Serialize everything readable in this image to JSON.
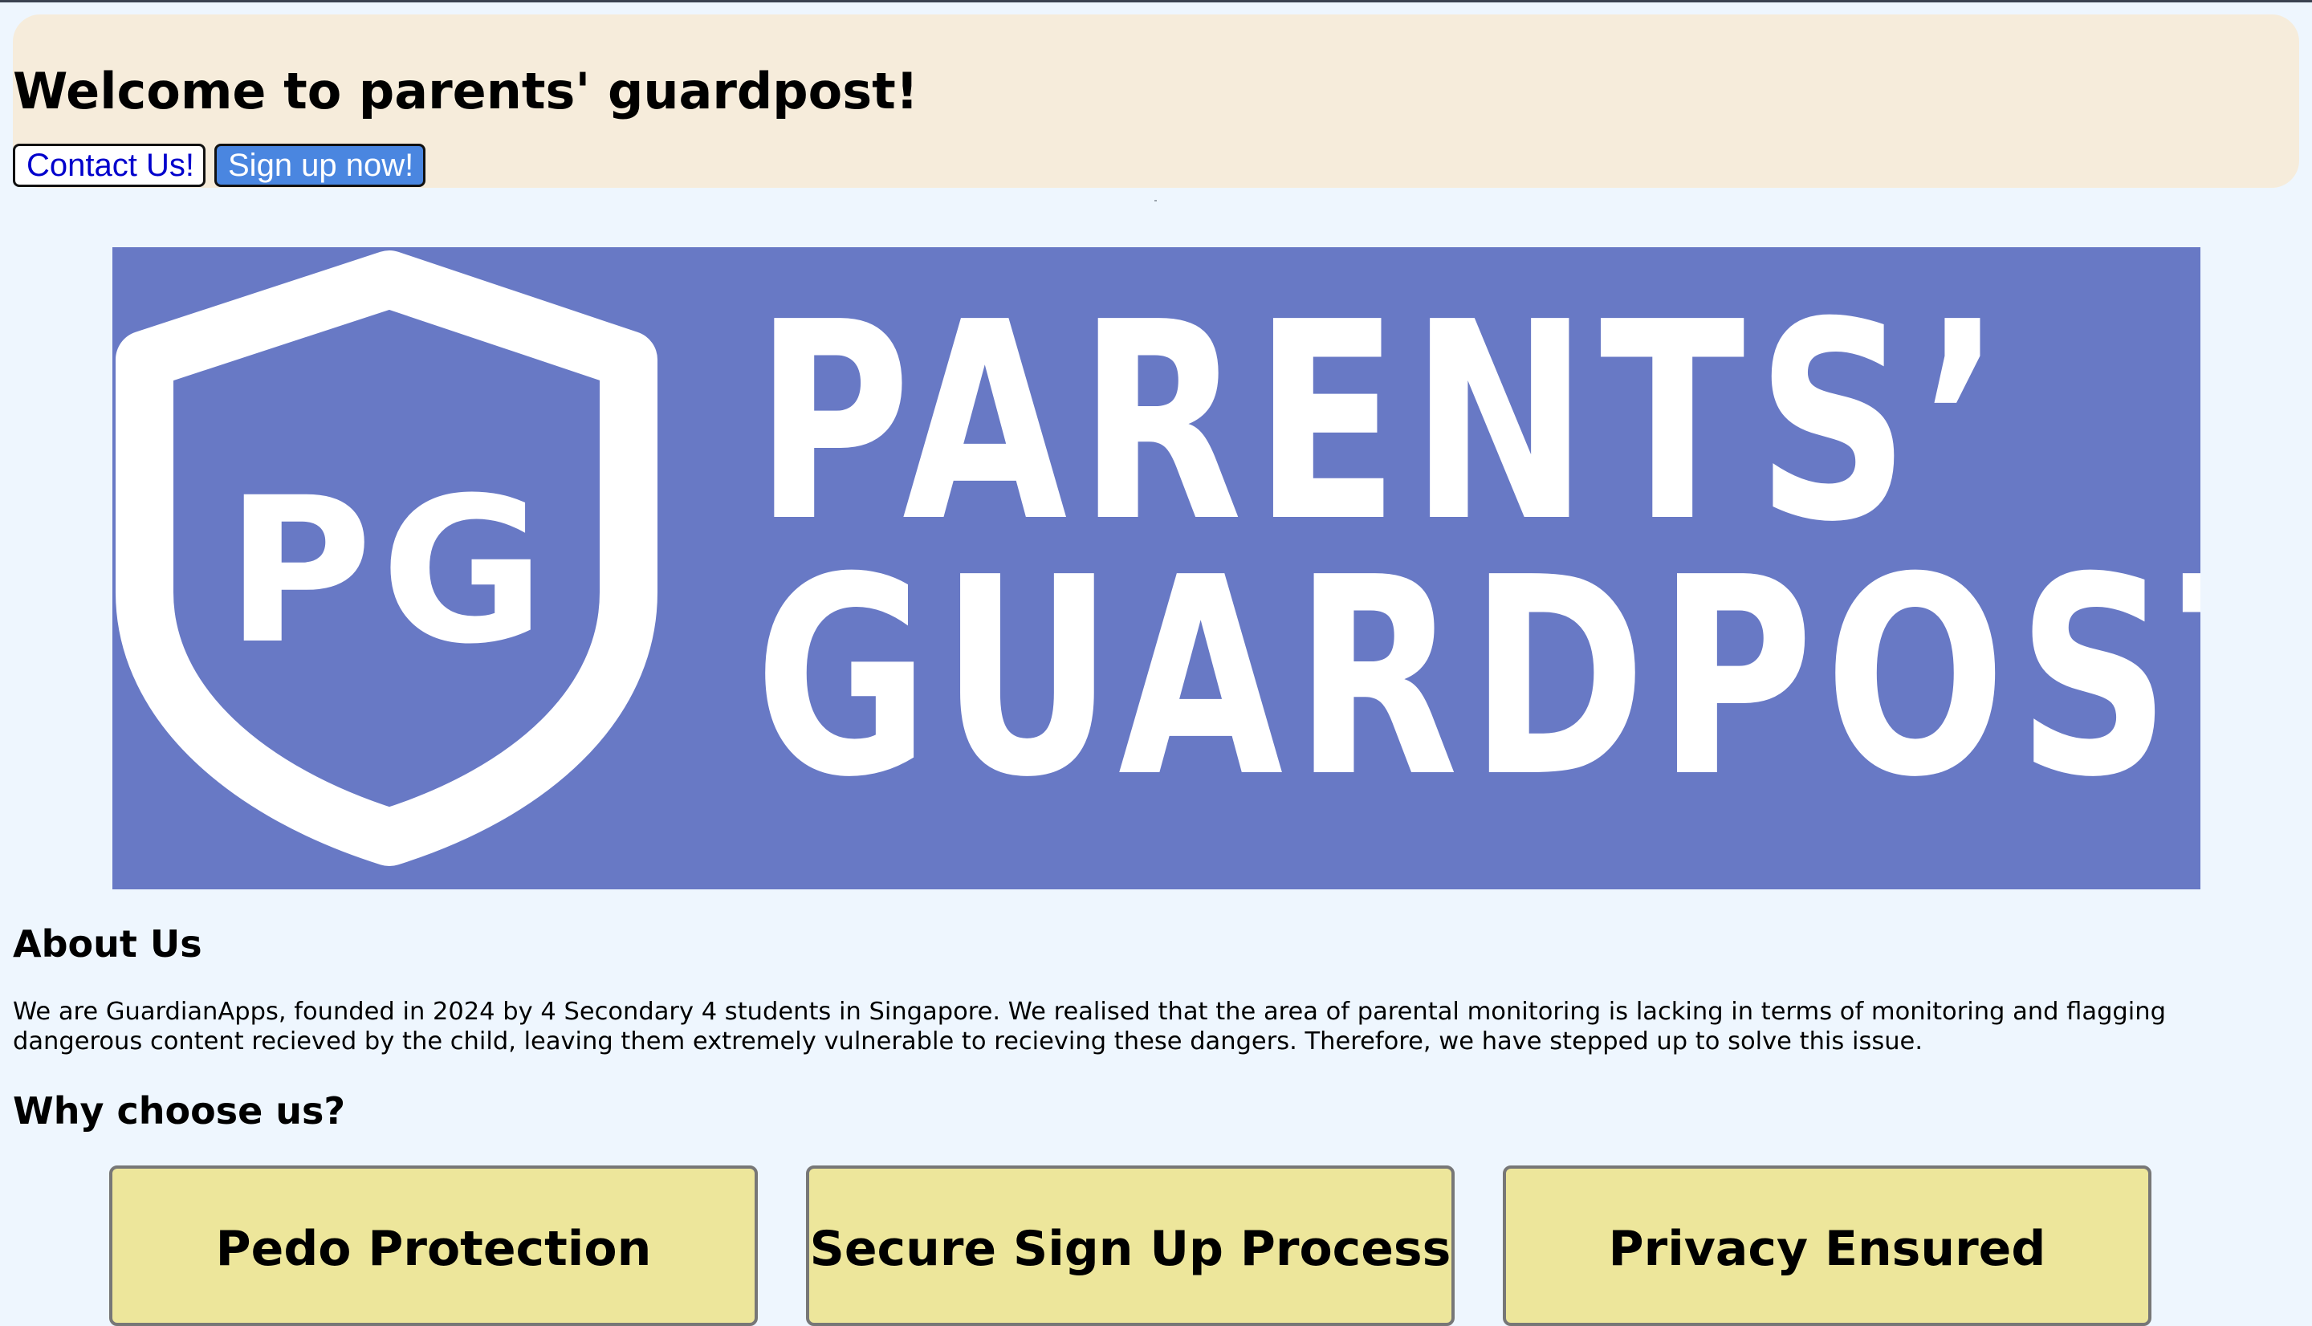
{
  "header": {
    "title": "Welcome to parents' guardpost!",
    "contact_button": "Contact Us!",
    "signup_button": "Sign up now!"
  },
  "banner": {
    "shield_initials": "PG",
    "line1": "PARENTS’",
    "line2": "GUARDPOST",
    "background_color": "#6879c5"
  },
  "about": {
    "heading": "About Us",
    "text": "We are GuardianApps, founded in 2024 by 4 Secondary 4 students in Singapore. We realised that the area of parental monitoring is lacking in terms of monitoring and flagging dangerous content recieved by the child, leaving them extremely vulnerable to recieving these dangers. Therefore, we have stepped up to solve this issue."
  },
  "why": {
    "heading": "Why choose us?",
    "cards": [
      {
        "title": "Pedo Protection"
      },
      {
        "title": "Secure Sign Up Process"
      },
      {
        "title": "Privacy Ensured"
      }
    ]
  },
  "colors": {
    "page_background": "#eef6fe",
    "header_background": "#f6ecdb",
    "card_background": "#ede69b",
    "signup_button": "#4a86e0",
    "contact_text": "#0000cc"
  }
}
